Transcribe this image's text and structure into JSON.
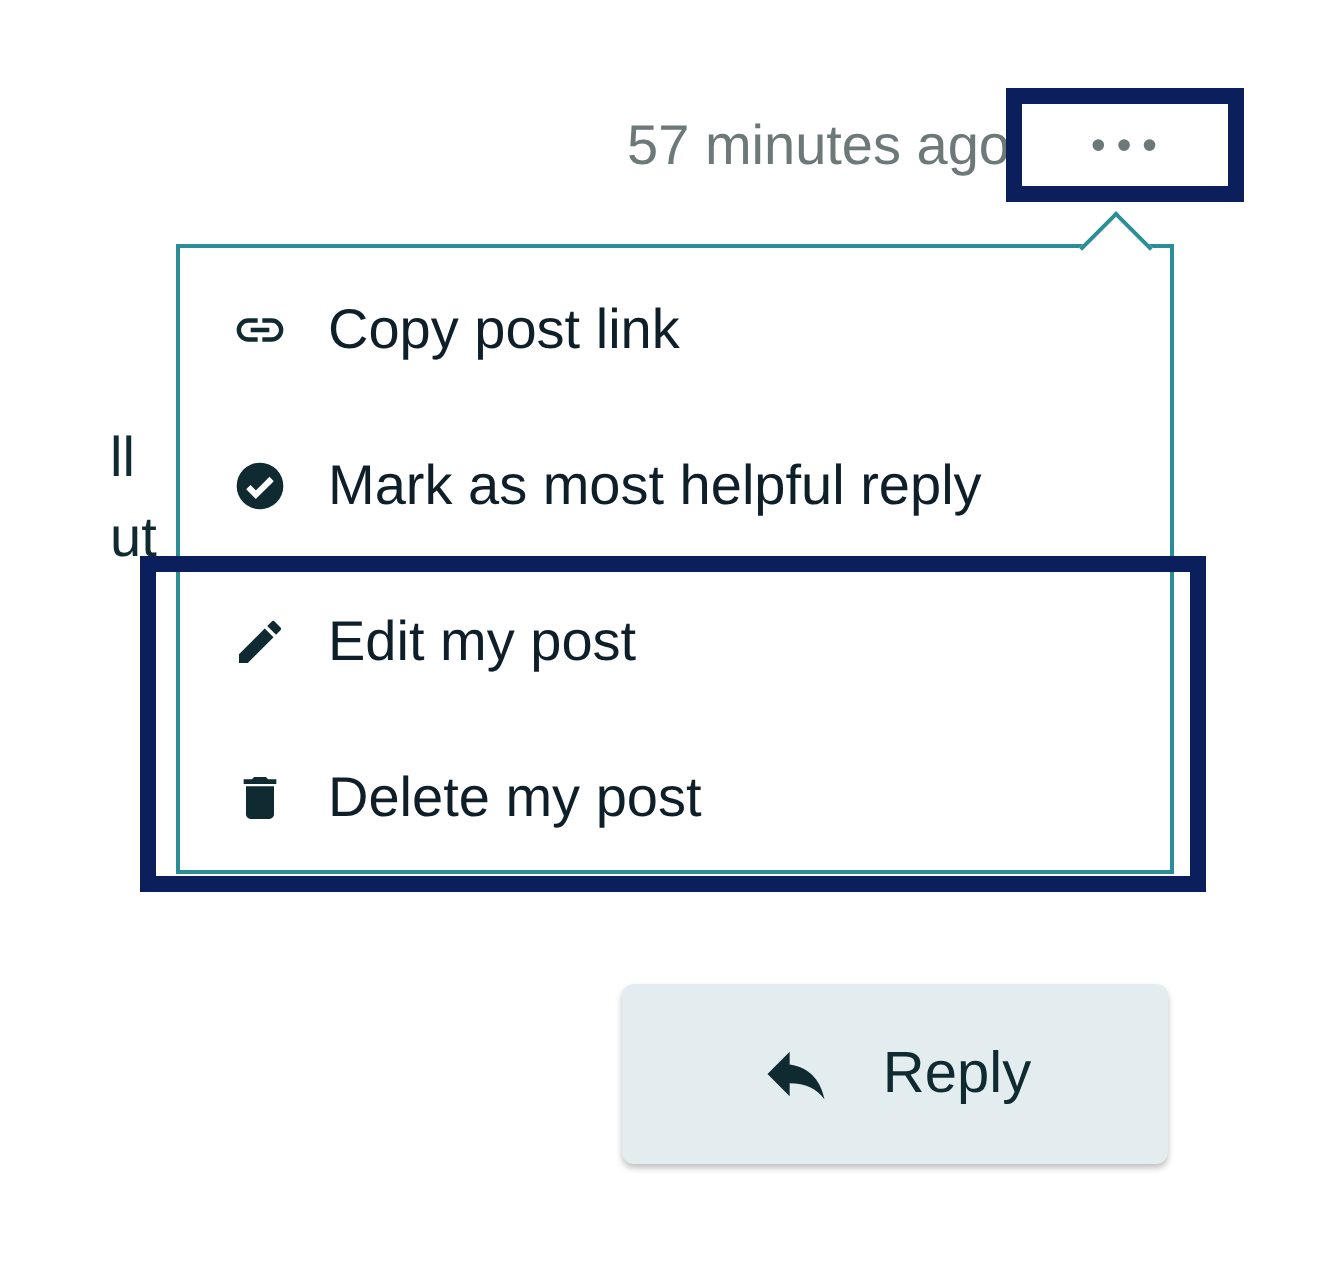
{
  "post": {
    "timestamp": "57 minutes ago",
    "more_button": {
      "label": "•••",
      "highlighted": true
    },
    "body_fragments": [
      "ll",
      "ut"
    ]
  },
  "menu": {
    "items": [
      {
        "kind": "link",
        "label": "Copy post link",
        "highlighted": false
      },
      {
        "kind": "check",
        "label": "Mark as most helpful reply",
        "highlighted": false
      },
      {
        "kind": "edit",
        "label": "Edit my post",
        "highlighted": true
      },
      {
        "kind": "delete",
        "label": "Delete my post",
        "highlighted": true
      }
    ]
  },
  "reply_button": {
    "label": "Reply"
  }
}
